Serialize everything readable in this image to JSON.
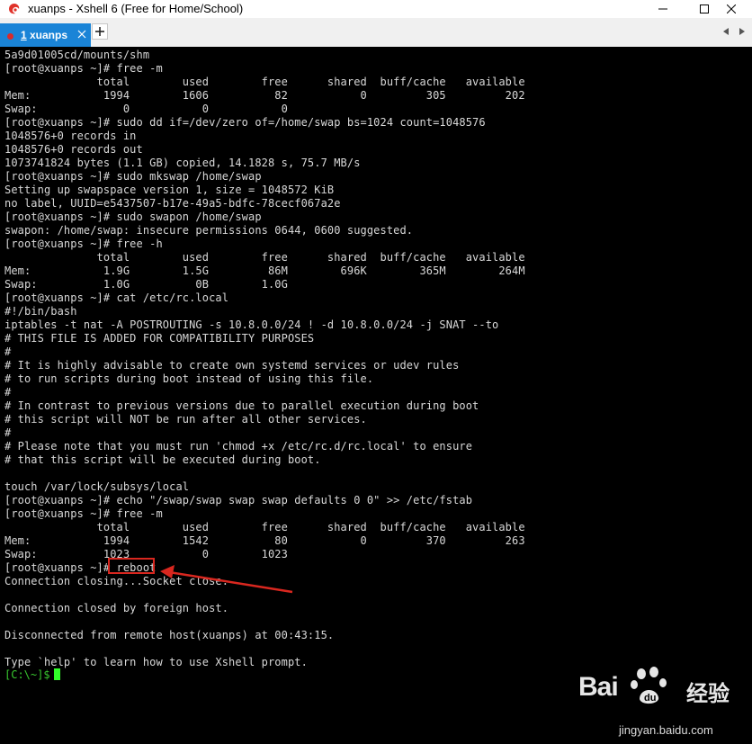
{
  "window": {
    "title": "xuanps - Xshell 6 (Free for Home/School)",
    "controls": [
      "minimize",
      "maximize",
      "close"
    ]
  },
  "tabs": [
    {
      "number": "1",
      "label": "xuanps",
      "active": true,
      "status_color": "#d92b2b"
    }
  ],
  "tab_add_label": "+",
  "terminal": {
    "lines": [
      "5a9d01005cd/mounts/shm",
      "[root@xuanps ~]# free -m",
      "              total        used        free      shared  buff/cache   available",
      "Mem:           1994        1606          82           0         305         202",
      "Swap:             0           0           0",
      "[root@xuanps ~]# sudo dd if=/dev/zero of=/home/swap bs=1024 count=1048576",
      "1048576+0 records in",
      "1048576+0 records out",
      "1073741824 bytes (1.1 GB) copied, 14.1828 s, 75.7 MB/s",
      "[root@xuanps ~]# sudo mkswap /home/swap",
      "Setting up swapspace version 1, size = 1048572 KiB",
      "no label, UUID=e5437507-b17e-49a5-bdfc-78cecf067a2e",
      "[root@xuanps ~]# sudo swapon /home/swap",
      "swapon: /home/swap: insecure permissions 0644, 0600 suggested.",
      "[root@xuanps ~]# free -h",
      "              total        used        free      shared  buff/cache   available",
      "Mem:           1.9G        1.5G         86M        696K        365M        264M",
      "Swap:          1.0G          0B        1.0G",
      "[root@xuanps ~]# cat /etc/rc.local",
      "#!/bin/bash",
      "iptables -t nat -A POSTROUTING -s 10.8.0.0/24 ! -d 10.8.0.0/24 -j SNAT --to",
      "# THIS FILE IS ADDED FOR COMPATIBILITY PURPOSES",
      "#",
      "# It is highly advisable to create own systemd services or udev rules",
      "# to run scripts during boot instead of using this file.",
      "#",
      "# In contrast to previous versions due to parallel execution during boot",
      "# this script will NOT be run after all other services.",
      "#",
      "# Please note that you must run 'chmod +x /etc/rc.d/rc.local' to ensure",
      "# that this script will be executed during boot.",
      "",
      "touch /var/lock/subsys/local",
      "[root@xuanps ~]# echo \"/swap/swap swap swap defaults 0 0\" >> /etc/fstab",
      "[root@xuanps ~]# free -m",
      "              total        used        free      shared  buff/cache   available",
      "Mem:           1994        1542          80           0         370         263",
      "Swap:          1023           0        1023",
      "[root@xuanps ~]# reboot",
      "Connection closing...Socket close.",
      "",
      "Connection closed by foreign host.",
      "",
      "Disconnected from remote host(xuanps) at 00:43:15.",
      "",
      "Type `help' to learn how to use Xshell prompt."
    ],
    "local_prompt": "[C:\\~]$",
    "text_color": "#d8d8d8",
    "prompt_color": "#39c92f",
    "background": "#000000"
  },
  "annotation": {
    "color": "#d9271f"
  },
  "watermark": {
    "brand": "Bai",
    "brand_cn": "经验",
    "url": "jingyan.baidu.com"
  }
}
